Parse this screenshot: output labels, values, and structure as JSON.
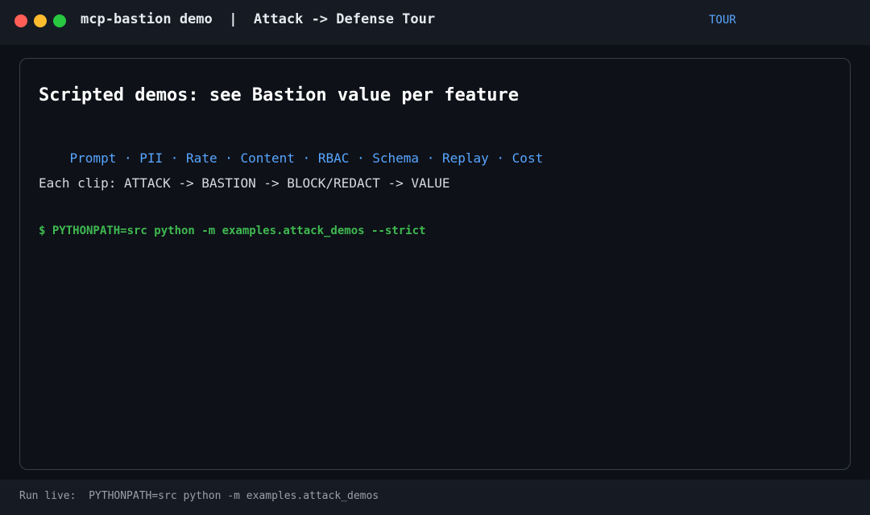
{
  "window": {
    "title": "mcp-bastion demo  |  Attack -> Defense Tour",
    "mode": "TOUR",
    "controls": [
      "close",
      "minimize",
      "maximize"
    ]
  },
  "panel": {
    "headline": "Scripted demos: see Bastion value per feature",
    "features": [
      "Prompt",
      "PII",
      "Rate",
      "Content",
      "RBAC",
      "Schema",
      "Replay",
      "Cost"
    ],
    "feature_separator": " · ",
    "flow": "Each clip: ATTACK -> BASTION -> BLOCK/REDACT -> VALUE",
    "command": "$ PYTHONPATH=src python -m examples.attack_demos --strict"
  },
  "footer": {
    "text": "Run live:  PYTHONPATH=src python -m examples.attack_demos"
  },
  "colors": {
    "background": "#0d1017",
    "bar": "#161b23",
    "accent": "#58a6ff",
    "command": "#3fb950",
    "close": "#ff5f57",
    "minimize": "#febc2e",
    "maximize": "#28c840"
  }
}
